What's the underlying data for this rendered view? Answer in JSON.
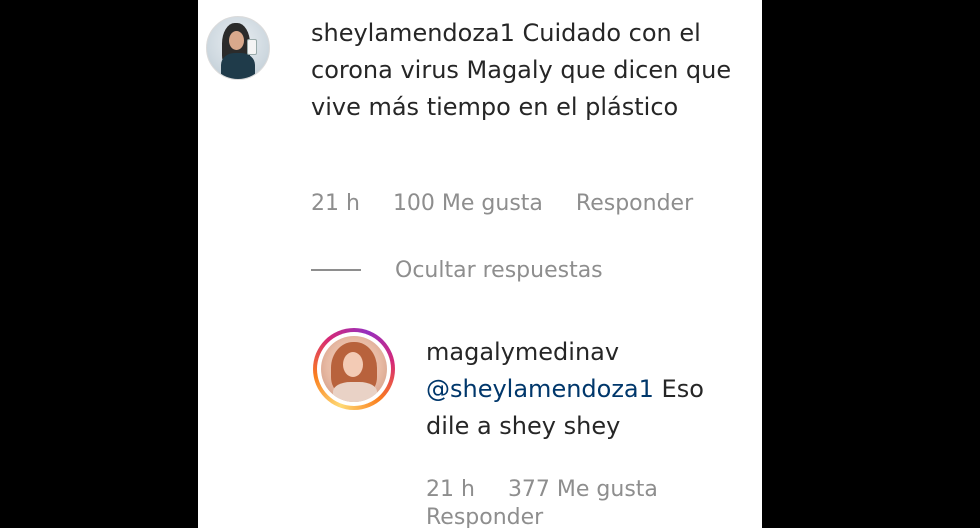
{
  "comment": {
    "username": "sheylamendoza1",
    "text": "Cuidado con el corona virus Magaly que dicen que vive más tiempo en el plástico",
    "time": "21 h",
    "likes": "100 Me gusta",
    "reply_label": "Responder"
  },
  "hide_replies_label": "Ocultar respuestas",
  "reply": {
    "username": "magalymedinav",
    "mention": "@sheylamendoza1",
    "text": "Eso dile a shey shey",
    "time": "21 h",
    "likes": "377 Me gusta",
    "reply_label": "Responder"
  },
  "colors": {
    "background": "#000000",
    "panel": "#ffffff",
    "text": "#262626",
    "meta": "#8e8e8e",
    "mention": "#00376b"
  }
}
